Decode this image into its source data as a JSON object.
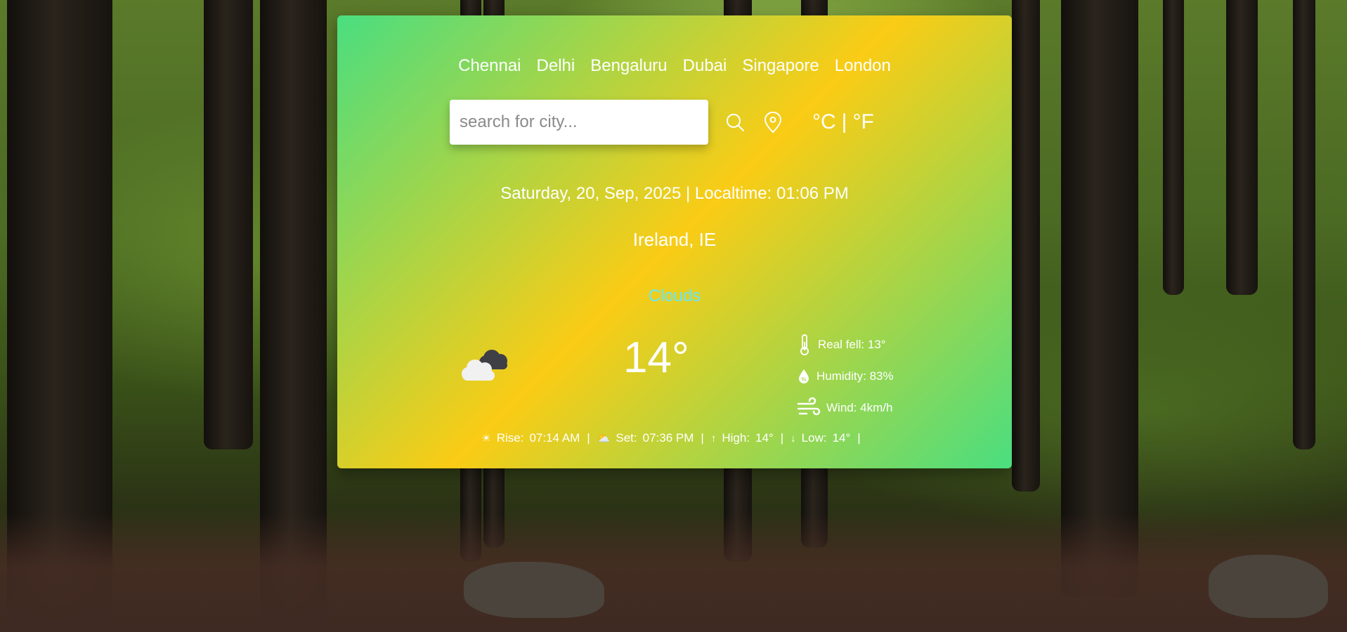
{
  "cities": [
    "Chennai",
    "Delhi",
    "Bengaluru",
    "Dubai",
    "Singapore",
    "London"
  ],
  "search": {
    "placeholder": "search for city..."
  },
  "icons": {
    "search": "search-icon",
    "location": "location-pin-icon",
    "temperature": "thermometer-icon",
    "humidity": "droplet-icon",
    "wind": "wind-icon",
    "weather": "cloud-icon",
    "sunrise": "sun-icon",
    "sunset": "cloud-sun-icon",
    "high": "arrow-up-icon",
    "low": "arrow-down-icon"
  },
  "units": {
    "celsius": "°C",
    "separator": "|",
    "fahrenheit": "°F"
  },
  "datetime": "Saturday, 20, Sep, 2025 | Localtime: 01:06 PM",
  "location": "Ireland, IE",
  "condition": "Clouds",
  "temperature": "14°",
  "details": {
    "real_feel": "Real fell: 13°",
    "humidity": "Humidity: 83%",
    "wind": "Wind: 4km/h"
  },
  "footer": {
    "rise_label": "Rise:",
    "rise_value": "07:14 AM",
    "set_label": "Set:",
    "set_value": "07:36 PM",
    "high_label": "High:",
    "high_value": "14°",
    "low_label": "Low:",
    "low_value": "14°",
    "separator": "|"
  },
  "colors": {
    "card_gradient_start": "#4ade80",
    "card_gradient_mid": "#facc15",
    "condition_text": "#67e8f9"
  }
}
